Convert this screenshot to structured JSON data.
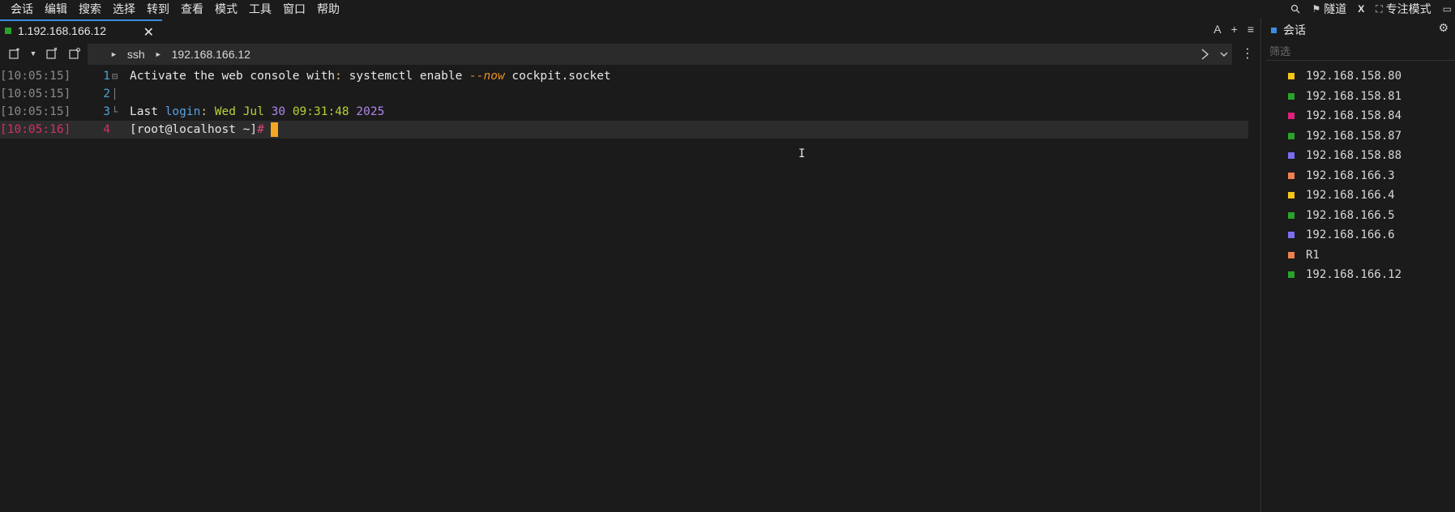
{
  "menu": [
    "会话",
    "编辑",
    "搜索",
    "选择",
    "转到",
    "查看",
    "模式",
    "工具",
    "窗口",
    "帮助"
  ],
  "topright": {
    "tunnel_label": "隧道",
    "x_label": "X",
    "focus_label": "专注模式"
  },
  "tab": {
    "title": "1.192.168.166.12",
    "color": "#2aa32a"
  },
  "tabtools": {
    "font_label": "A",
    "add_label": "+",
    "menu_label": "≡"
  },
  "breadcrumb": {
    "protocol": "ssh",
    "host": "192.168.166.12"
  },
  "terminal": {
    "lines": [
      {
        "ts": "[10:05:15]",
        "num": "1",
        "text": "Activate the web console with",
        "colon": ":",
        "text2": " systemctl enable ",
        "flag": "--now",
        "text3": " cockpit.socket"
      },
      {
        "ts": "[10:05:15]",
        "num": "2"
      },
      {
        "ts": "[10:05:15]",
        "num": "3",
        "w_last": "Last ",
        "w_login": "login",
        "w_colon": ": ",
        "w_wed": "Wed ",
        "w_jul": "Jul ",
        "w_30": "30 ",
        "w_time": "09:31:48 ",
        "w_year": "2025"
      },
      {
        "ts": "[10:05:16]",
        "num": "4",
        "prompt": "[root@localhost ~]",
        "hash": "#"
      }
    ]
  },
  "sessions_panel": {
    "title": "会话",
    "filter_placeholder": "筛选",
    "items": [
      {
        "name": "192.168.158.80",
        "color": "#f5c518"
      },
      {
        "name": "192.168.158.81",
        "color": "#2aa32a"
      },
      {
        "name": "192.168.158.84",
        "color": "#e0207a"
      },
      {
        "name": "192.168.158.87",
        "color": "#2aa32a"
      },
      {
        "name": "192.168.158.88",
        "color": "#7b6cf0"
      },
      {
        "name": "192.168.166.3",
        "color": "#f08050"
      },
      {
        "name": "192.168.166.4",
        "color": "#f5c518"
      },
      {
        "name": "192.168.166.5",
        "color": "#2aa32a"
      },
      {
        "name": "192.168.166.6",
        "color": "#7b6cf0"
      },
      {
        "name": "R1",
        "color": "#f08050"
      },
      {
        "name": "192.168.166.12",
        "color": "#2aa32a"
      }
    ]
  }
}
